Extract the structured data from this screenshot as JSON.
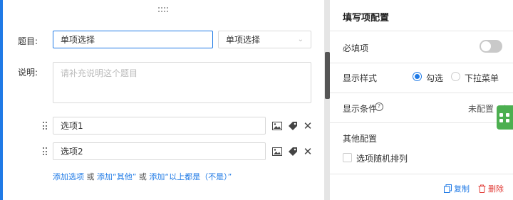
{
  "question": {
    "title_label": "题目:",
    "title_value": "单项选择",
    "type_select": "单项选择",
    "desc_label": "说明:",
    "desc_placeholder": "请补充说明这个题目",
    "options": [
      {
        "value": "选项1"
      },
      {
        "value": "选项2"
      }
    ],
    "add_links": {
      "add_option": "添加选项",
      "or1": "或",
      "add_other": "添加“其他”",
      "or2": "或",
      "add_none": "添加“以上都是（不是）”"
    }
  },
  "panel": {
    "title": "填写项配置",
    "required_label": "必填项",
    "required_on": false,
    "display_style_label": "显示样式",
    "style_options": [
      "勾选",
      "下拉菜单"
    ],
    "style_selected": "勾选",
    "condition_label": "显示条件",
    "condition_value": "未配置",
    "other_config_label": "其他配置",
    "random_order_label": "选项随机排列",
    "copy_label": "复制",
    "delete_label": "删除"
  },
  "colors": {
    "accent": "#1f7ae6",
    "danger": "#e2403b",
    "green_tab": "#4caf50"
  }
}
